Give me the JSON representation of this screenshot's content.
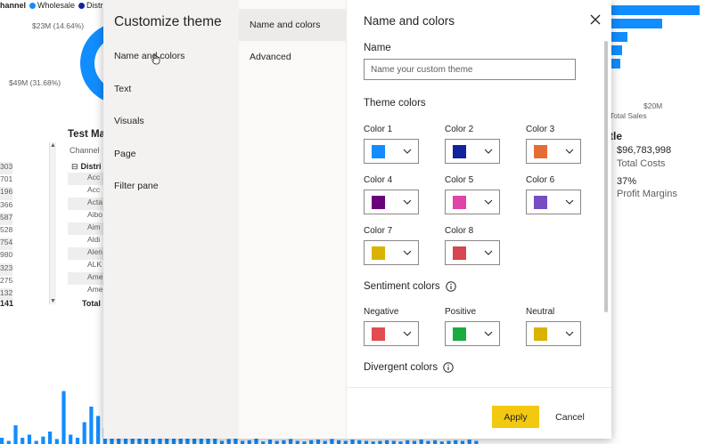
{
  "report": {
    "legend": {
      "channel_label": "hannel",
      "items": [
        {
          "label": "Wholesale",
          "color": "#118dff"
        },
        {
          "label": "Distr",
          "color": "#12239e"
        }
      ]
    },
    "donut": {
      "label_top": "$23M (14.64%)",
      "label_left": "$49M (31.68%)",
      "slices": [
        {
          "fraction": 0.1464,
          "color": "#e66c37"
        },
        {
          "fraction": 0.3168,
          "color": "#12239e"
        },
        {
          "fraction": 0.5368,
          "color": "#118dff"
        }
      ]
    },
    "table": {
      "title": "Test Ma",
      "column_header": "Channel",
      "group_label": "Distri",
      "rows": [
        "Acc",
        "Acc",
        "Acta",
        "Aibo",
        "Aim",
        "Aldi",
        "Alen",
        "ALK",
        "Ame",
        "Ame"
      ],
      "total_label": "Total",
      "left_values": [
        "303",
        "701",
        "196",
        "366",
        "587",
        "528",
        "754",
        "980",
        "323",
        "275",
        "132"
      ],
      "left_total": "141"
    },
    "right_chart": {
      "bar_values": [
        0.95,
        0.55,
        0.17,
        0.12,
        0.1
      ],
      "tick_label": "$20M",
      "axis_title": "Total Sales"
    },
    "cards": {
      "title": "tle",
      "value1": "$96,783,998",
      "label1": "Total Costs",
      "value2": "37%",
      "label2": "Profit Margins"
    },
    "bottom_chart": {
      "values": [
        0.1,
        0.05,
        0.3,
        0.1,
        0.15,
        0.05,
        0.12,
        0.2,
        0.08,
        0.85,
        0.15,
        0.1,
        0.35,
        0.6,
        0.45,
        0.25,
        0.9,
        0.5,
        0.3,
        0.7,
        0.4,
        0.2,
        0.95,
        0.55,
        0.35,
        0.6,
        0.3,
        0.15,
        0.2,
        0.1,
        0.25,
        0.12,
        0.05,
        0.08,
        0.1,
        0.05,
        0.06,
        0.09,
        0.04,
        0.07,
        0.05,
        0.06,
        0.08,
        0.05,
        0.04,
        0.06,
        0.07,
        0.05,
        0.08,
        0.06,
        0.05,
        0.07,
        0.06,
        0.05,
        0.04,
        0.05,
        0.06,
        0.05,
        0.04,
        0.06,
        0.05,
        0.07,
        0.05,
        0.06,
        0.04,
        0.05,
        0.06,
        0.05,
        0.07,
        0.05
      ]
    }
  },
  "dialog": {
    "title": "Customize theme",
    "nav": [
      {
        "label": "Name and colors",
        "name": "nav-name-and-colors"
      },
      {
        "label": "Text",
        "name": "nav-text"
      },
      {
        "label": "Visuals",
        "name": "nav-visuals"
      },
      {
        "label": "Page",
        "name": "nav-page"
      },
      {
        "label": "Filter pane",
        "name": "nav-filter-pane"
      }
    ],
    "subnav": [
      {
        "label": "Name and colors",
        "active": true
      },
      {
        "label": "Advanced",
        "active": false
      }
    ],
    "content_title": "Name and colors",
    "name_section": {
      "label": "Name",
      "placeholder": "Name your custom theme"
    },
    "theme_colors": {
      "label": "Theme colors",
      "colors": [
        {
          "label": "Color 1",
          "hex": "#118dff"
        },
        {
          "label": "Color 2",
          "hex": "#12239e"
        },
        {
          "label": "Color 3",
          "hex": "#e66c37"
        },
        {
          "label": "Color 4",
          "hex": "#6b007b"
        },
        {
          "label": "Color 5",
          "hex": "#e044a7"
        },
        {
          "label": "Color 6",
          "hex": "#744ec2"
        },
        {
          "label": "Color 7",
          "hex": "#d9b300"
        },
        {
          "label": "Color 8",
          "hex": "#d64550"
        }
      ]
    },
    "sentiment_colors": {
      "label": "Sentiment colors",
      "colors": [
        {
          "label": "Negative",
          "hex": "#e04c50"
        },
        {
          "label": "Positive",
          "hex": "#1aab40"
        },
        {
          "label": "Neutral",
          "hex": "#d9b300"
        }
      ]
    },
    "divergent_colors": {
      "label": "Divergent colors"
    },
    "footer": {
      "apply_label": "Apply",
      "cancel_label": "Cancel"
    }
  }
}
